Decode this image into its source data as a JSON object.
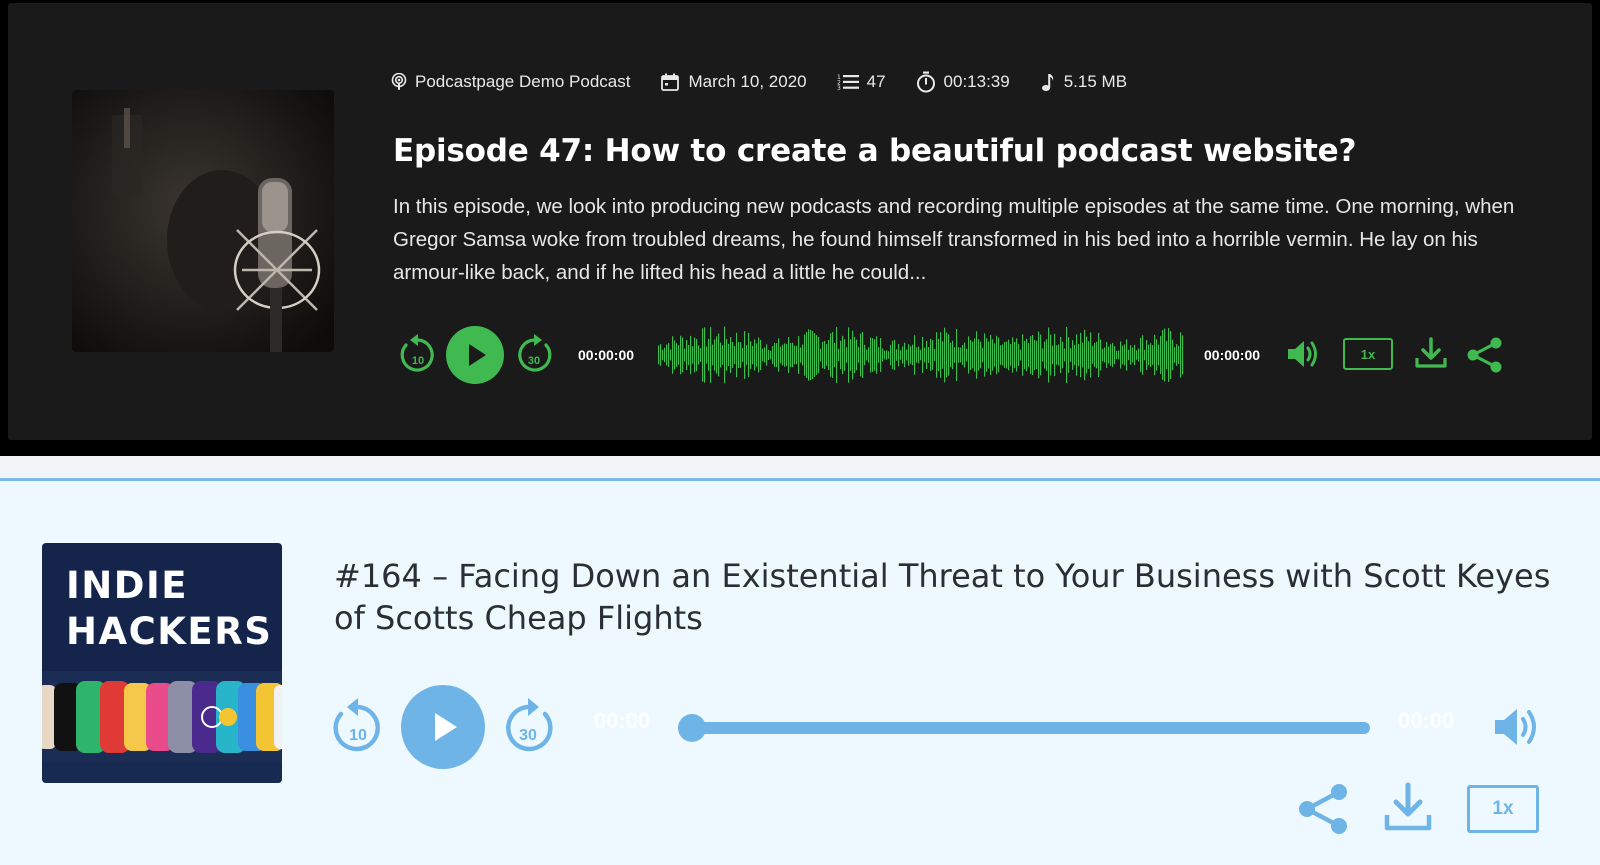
{
  "player_dark": {
    "meta": {
      "podcast": "Podcastpage Demo Podcast",
      "date": "March 10, 2020",
      "episode_number": "47",
      "duration": "00:13:39",
      "file_size": "5.15 MB"
    },
    "title": "Episode 47: How to create a beautiful podcast website?",
    "description": "In this episode, we look into producing new podcasts and recording multiple episodes at the same time. One morning, when Gregor Samsa woke from troubled dreams, he found himself transformed in his bed into a horrible vermin. He lay on his armour-like back, and if he lifted his head a little he could...",
    "controls": {
      "rewind_seconds": "10",
      "forward_seconds": "30",
      "current_time": "00:00:00",
      "total_time": "00:00:00",
      "speed": "1x"
    },
    "colors": {
      "accent": "#3fb950",
      "background": "#1a1a1a"
    },
    "icons": [
      "podcast-icon",
      "calendar-icon",
      "list-icon",
      "stopwatch-icon",
      "music-note-icon",
      "rewind-icon",
      "play-icon",
      "forward-icon",
      "volume-icon",
      "download-icon",
      "share-icon"
    ]
  },
  "player_light": {
    "artwork_text": [
      "INDIE",
      "HACKERS"
    ],
    "title": "#164 – Facing Down an Existential Threat to Your Business with Scott Keyes of Scotts Cheap Flights",
    "controls": {
      "rewind_seconds": "10",
      "forward_seconds": "30",
      "current_time": "00:00",
      "total_time": "00:00",
      "speed": "1x",
      "progress": 0
    },
    "colors": {
      "accent": "#6fb4e6",
      "background": "#eef9ff"
    },
    "icons": [
      "rewind-icon",
      "play-icon",
      "forward-icon",
      "volume-icon",
      "share-icon",
      "download-icon"
    ]
  }
}
